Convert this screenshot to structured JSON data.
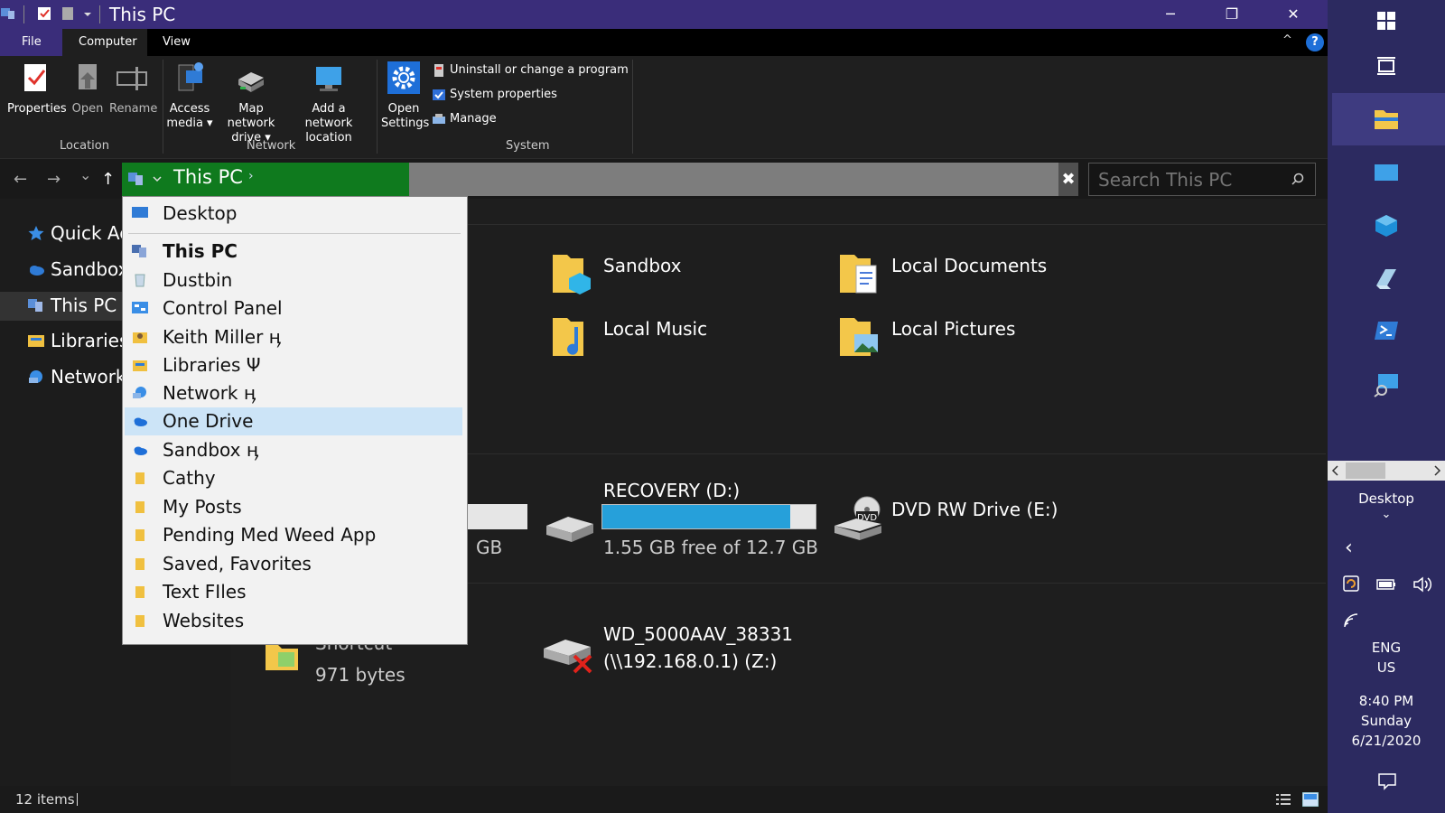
{
  "window": {
    "title": "This PC",
    "minimize": "─",
    "restore": "❐",
    "close": "✕"
  },
  "ribbon": {
    "tabs": [
      "File",
      "Computer",
      "View"
    ],
    "help": "?",
    "collapse": "^",
    "groups": {
      "location": {
        "label": "Location",
        "buttons": [
          "Properties",
          "Open",
          "Rename"
        ]
      },
      "network": {
        "label": "Network",
        "access_media": [
          "Access",
          "media ▾"
        ],
        "map_network_drive": [
          "Map network",
          "drive ▾"
        ],
        "add_network_location": [
          "Add a network",
          "location"
        ]
      },
      "system": {
        "label": "System",
        "open_settings": [
          "Open",
          "Settings"
        ],
        "uninstall": "Uninstall or change a program",
        "system_properties": "System properties",
        "manage": "Manage"
      }
    }
  },
  "address_bar": {
    "path": "This PC",
    "separator": "›",
    "search_placeholder": "Search This PC",
    "clear": "✖"
  },
  "nav": {
    "back": "←",
    "forward": "→",
    "recent": "⌄",
    "up": "↑"
  },
  "nav_pane": {
    "items": [
      "Quick Ac",
      "Sandbox",
      "This PC",
      "Libraries",
      "Network"
    ]
  },
  "dropdown": {
    "items": [
      "Desktop",
      "This PC",
      "Dustbin",
      "Control Panel",
      "Keith Miller ӊ",
      "Libraries Ψ",
      "Network ӊ",
      "One Drive",
      "Sandbox ӊ",
      "Cathy",
      "My Posts",
      "Pending Med Weed App",
      "Saved, Favorites",
      "Text FIles",
      "Websites"
    ],
    "selected": "One Drive"
  },
  "content": {
    "folders": [
      "Sandbox",
      "Local Documents",
      "Local Music",
      "Local Pictures"
    ],
    "drives": {
      "c_partial_size": "GB",
      "recovery": {
        "name": "RECOVERY (D:)",
        "free": "1.55 GB free of 12.7 GB",
        "used_fraction": 0.88
      },
      "dvd": "DVD RW Drive (E:)"
    },
    "network": {
      "shortcut_label": "Shortcut",
      "shortcut_size": "971 bytes",
      "wd_name": "WD_5000AAV_38331",
      "wd_path": "(\\\\192.168.0.1) (Z:)"
    }
  },
  "status": {
    "items": "12 items"
  },
  "taskbar": {
    "desktop_label": "Desktop",
    "desktop_chevron": "⌄",
    "back": "‹",
    "lang1": "ENG",
    "lang2": "US",
    "time": "8:40 PM",
    "day": "Sunday",
    "date": "6/21/2020"
  },
  "colors": {
    "title_bar": "#3a2d7a",
    "address_green": "#0f7a1e",
    "selection": "#cce4f7",
    "progress": "#26a0da"
  }
}
